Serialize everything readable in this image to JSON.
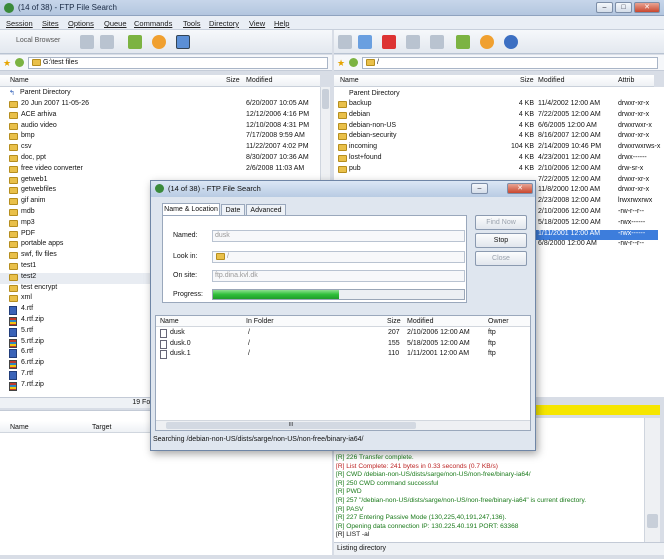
{
  "window": {
    "title": "(14 of 38) - FTP File Search"
  },
  "menu": [
    "Session",
    "Sites",
    "Options",
    "Queue",
    "Commands",
    "Tools",
    "Directory",
    "View",
    "Help"
  ],
  "toolbar": {
    "local_browser": "Local Browser"
  },
  "left": {
    "path": "G:\\test files",
    "col_name": "Name",
    "col_size": "Size",
    "col_modified": "Modified",
    "parent": "Parent Directory",
    "rows": [
      {
        "name": "20 Jun 2007 11-05-26",
        "mod": "6/20/2007 10:05 AM",
        "type": "folder"
      },
      {
        "name": "ACE arhiva",
        "mod": "12/12/2006 4:16 PM",
        "type": "folder"
      },
      {
        "name": "audio video",
        "mod": "12/10/2008 4:31 PM",
        "type": "folder"
      },
      {
        "name": "bmp",
        "mod": "7/17/2008 9:59 AM",
        "type": "folder"
      },
      {
        "name": "csv",
        "mod": "11/22/2007 4:02 PM",
        "type": "folder"
      },
      {
        "name": "doc, ppt",
        "mod": "8/30/2007 10:36 AM",
        "type": "folder"
      },
      {
        "name": "free video converter",
        "mod": "2/6/2008 11:03 AM",
        "type": "folder"
      },
      {
        "name": "getweb1",
        "mod": "",
        "type": "folder"
      },
      {
        "name": "getwebfiles",
        "mod": "",
        "type": "folder"
      },
      {
        "name": "gif anim",
        "mod": "",
        "type": "folder"
      },
      {
        "name": "mdb",
        "mod": "",
        "type": "folder"
      },
      {
        "name": "mp3",
        "mod": "",
        "type": "folder"
      },
      {
        "name": "PDF",
        "mod": "",
        "type": "folder"
      },
      {
        "name": "portable apps",
        "mod": "",
        "type": "folder"
      },
      {
        "name": "swf, flv files",
        "mod": "",
        "type": "folder"
      },
      {
        "name": "test1",
        "mod": "",
        "type": "folder"
      },
      {
        "name": "test2",
        "mod": "",
        "type": "folder"
      },
      {
        "name": "test encrypt",
        "mod": "",
        "type": "folder"
      },
      {
        "name": "xml",
        "mod": "",
        "type": "folder"
      },
      {
        "name": "4.rtf",
        "mod": "",
        "type": "rtf"
      },
      {
        "name": "4.rtf.zip",
        "mod": "",
        "type": "zip"
      },
      {
        "name": "5.rtf",
        "mod": "",
        "type": "rtf"
      },
      {
        "name": "5.rtf.zip",
        "mod": "",
        "type": "zip"
      },
      {
        "name": "6.rtf",
        "mod": "",
        "type": "rtf"
      },
      {
        "name": "6.rtf.zip",
        "mod": "",
        "type": "zip"
      },
      {
        "name": "7.rtf",
        "mod": "",
        "type": "rtf"
      },
      {
        "name": "7.rtf.zip",
        "mod": "",
        "type": "zip"
      }
    ],
    "status": "19 Folders, 356 Files"
  },
  "right": {
    "path": "/",
    "col_name": "Name",
    "col_size": "Size",
    "col_modified": "Modified",
    "col_attrib": "Attrib",
    "parent": "Parent Directory",
    "rows": [
      {
        "name": "backup",
        "size": "4 KB",
        "mod": "11/4/2002 12:00 AM",
        "attr": "drwxr-xr-x"
      },
      {
        "name": "debian",
        "size": "4 KB",
        "mod": "7/22/2005 12:00 AM",
        "attr": "drwxr-xr-x"
      },
      {
        "name": "debian-non-US",
        "size": "4 KB",
        "mod": "6/6/2005 12:00 AM",
        "attr": "drwxrwxr-x"
      },
      {
        "name": "debian-security",
        "size": "4 KB",
        "mod": "8/16/2007 12:00 AM",
        "attr": "drwxr-xr-x"
      },
      {
        "name": "incoming",
        "size": "104 KB",
        "mod": "2/14/2009 10:46 PM",
        "attr": "drwxrwxrws-x"
      },
      {
        "name": "lost+found",
        "size": "4 KB",
        "mod": "4/23/2001 12:00 AM",
        "attr": "drwx------"
      },
      {
        "name": "pub",
        "size": "4 KB",
        "mod": "2/10/2006 12:00 AM",
        "attr": "drw-sr-x"
      },
      {
        "name": "",
        "size": "",
        "mod": "7/22/2005 12:00 AM",
        "attr": "drwxr-xr-x"
      },
      {
        "name": "",
        "size": "",
        "mod": "11/8/2000 12:00 AM",
        "attr": "drwxr-xr-x"
      },
      {
        "name": "",
        "size": "",
        "mod": "2/23/2008 12:00 AM",
        "attr": "lrwxrwxrwx"
      },
      {
        "name": "",
        "size": "",
        "mod": "2/10/2006 12:00 AM",
        "attr": "-rw-r--r--"
      },
      {
        "name": "",
        "size": "",
        "mod": "5/18/2005 12:00 AM",
        "attr": "-rwx------"
      },
      {
        "name": "",
        "size": "",
        "mod": "1/11/2001 12:00 AM",
        "attr": "-rwx------"
      },
      {
        "name": "",
        "size": "",
        "mod": "6/8/2000 12:00 AM",
        "attr": "-rw-r--r--"
      }
    ]
  },
  "queue": {
    "col_name": "Name",
    "col_target": "Target"
  },
  "log": [
    {
      "text": "[R] 226 Transfer complete.",
      "c": "g"
    },
    {
      "text": "[R] List Complete: 241 bytes in 0.33 seconds (0.7 KB/s)",
      "c": "r"
    },
    {
      "text": "[R] CWD /debian-non-US/dists/sarge/non-US/non-free/binary-ia64/",
      "c": "g"
    },
    {
      "text": "[R] 250 CWD command successful",
      "c": "g"
    },
    {
      "text": "[R] PWD",
      "c": "g"
    },
    {
      "text": "[R] 257 \"/debian-non-US/dists/sarge/non-US/non-free/binary-ia64\" is current directory.",
      "c": "g"
    },
    {
      "text": "[R] PASV",
      "c": "g"
    },
    {
      "text": "[R] 227 Entering Passive Mode (130,225,40,191,247,136).",
      "c": "g"
    },
    {
      "text": "[R] Opening data connection IP: 130.225.40.191 PORT: 63368",
      "c": "g"
    },
    {
      "text": "[R] LIST -al",
      "c": "b"
    }
  ],
  "log_status": "Listing directory",
  "dialog": {
    "title": "(14 of 38) - FTP File Search",
    "tabs": [
      "Name & Location",
      "Date",
      "Advanced"
    ],
    "named_label": "Named:",
    "named_value": "dusk",
    "lookin_label": "Look in:",
    "lookin_value": "/",
    "onsite_label": "On site:",
    "onsite_value": "ftp.dina.kvl.dk",
    "progress_label": "Progress:",
    "progress": 0.5,
    "btn_find": "Find Now",
    "btn_stop": "Stop",
    "btn_close": "Close",
    "res_headers": {
      "name": "Name",
      "folder": "In Folder",
      "size": "Size",
      "modified": "Modified",
      "owner": "Owner"
    },
    "results": [
      {
        "name": "dusk",
        "folder": "/",
        "size": "207",
        "mod": "2/10/2006 12:00 AM",
        "owner": "ftp"
      },
      {
        "name": "dusk.0",
        "folder": "/",
        "size": "155",
        "mod": "5/18/2005 12:00 AM",
        "owner": "ftp"
      },
      {
        "name": "dusk.1",
        "folder": "/",
        "size": "110",
        "mod": "1/11/2001 12:00 AM",
        "owner": "ftp"
      }
    ],
    "scroll_glyph": "III",
    "status": "Searching /debian-non-US/dists/sarge/non-US/non-free/binary-ia64/"
  },
  "colors": {
    "accent": "#3d7ddc",
    "progress": "#2fbf3a",
    "log_green": "#1a7a1a",
    "log_red": "#b22222"
  }
}
